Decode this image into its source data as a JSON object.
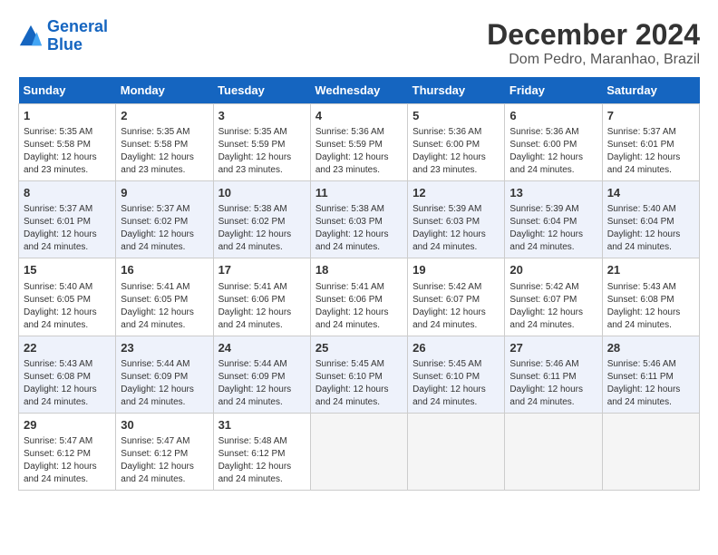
{
  "header": {
    "logo_line1": "General",
    "logo_line2": "Blue",
    "title": "December 2024",
    "subtitle": "Dom Pedro, Maranhao, Brazil"
  },
  "calendar": {
    "days_of_week": [
      "Sunday",
      "Monday",
      "Tuesday",
      "Wednesday",
      "Thursday",
      "Friday",
      "Saturday"
    ],
    "weeks": [
      [
        {
          "day": "",
          "detail": ""
        },
        {
          "day": "2",
          "detail": "Sunrise: 5:35 AM\nSunset: 5:58 PM\nDaylight: 12 hours\nand 23 minutes."
        },
        {
          "day": "3",
          "detail": "Sunrise: 5:35 AM\nSunset: 5:59 PM\nDaylight: 12 hours\nand 23 minutes."
        },
        {
          "day": "4",
          "detail": "Sunrise: 5:36 AM\nSunset: 5:59 PM\nDaylight: 12 hours\nand 23 minutes."
        },
        {
          "day": "5",
          "detail": "Sunrise: 5:36 AM\nSunset: 6:00 PM\nDaylight: 12 hours\nand 23 minutes."
        },
        {
          "day": "6",
          "detail": "Sunrise: 5:36 AM\nSunset: 6:00 PM\nDaylight: 12 hours\nand 24 minutes."
        },
        {
          "day": "7",
          "detail": "Sunrise: 5:37 AM\nSunset: 6:01 PM\nDaylight: 12 hours\nand 24 minutes."
        }
      ],
      [
        {
          "day": "8",
          "detail": "Sunrise: 5:37 AM\nSunset: 6:01 PM\nDaylight: 12 hours\nand 24 minutes."
        },
        {
          "day": "9",
          "detail": "Sunrise: 5:37 AM\nSunset: 6:02 PM\nDaylight: 12 hours\nand 24 minutes."
        },
        {
          "day": "10",
          "detail": "Sunrise: 5:38 AM\nSunset: 6:02 PM\nDaylight: 12 hours\nand 24 minutes."
        },
        {
          "day": "11",
          "detail": "Sunrise: 5:38 AM\nSunset: 6:03 PM\nDaylight: 12 hours\nand 24 minutes."
        },
        {
          "day": "12",
          "detail": "Sunrise: 5:39 AM\nSunset: 6:03 PM\nDaylight: 12 hours\nand 24 minutes."
        },
        {
          "day": "13",
          "detail": "Sunrise: 5:39 AM\nSunset: 6:04 PM\nDaylight: 12 hours\nand 24 minutes."
        },
        {
          "day": "14",
          "detail": "Sunrise: 5:40 AM\nSunset: 6:04 PM\nDaylight: 12 hours\nand 24 minutes."
        }
      ],
      [
        {
          "day": "15",
          "detail": "Sunrise: 5:40 AM\nSunset: 6:05 PM\nDaylight: 12 hours\nand 24 minutes."
        },
        {
          "day": "16",
          "detail": "Sunrise: 5:41 AM\nSunset: 6:05 PM\nDaylight: 12 hours\nand 24 minutes."
        },
        {
          "day": "17",
          "detail": "Sunrise: 5:41 AM\nSunset: 6:06 PM\nDaylight: 12 hours\nand 24 minutes."
        },
        {
          "day": "18",
          "detail": "Sunrise: 5:41 AM\nSunset: 6:06 PM\nDaylight: 12 hours\nand 24 minutes."
        },
        {
          "day": "19",
          "detail": "Sunrise: 5:42 AM\nSunset: 6:07 PM\nDaylight: 12 hours\nand 24 minutes."
        },
        {
          "day": "20",
          "detail": "Sunrise: 5:42 AM\nSunset: 6:07 PM\nDaylight: 12 hours\nand 24 minutes."
        },
        {
          "day": "21",
          "detail": "Sunrise: 5:43 AM\nSunset: 6:08 PM\nDaylight: 12 hours\nand 24 minutes."
        }
      ],
      [
        {
          "day": "22",
          "detail": "Sunrise: 5:43 AM\nSunset: 6:08 PM\nDaylight: 12 hours\nand 24 minutes."
        },
        {
          "day": "23",
          "detail": "Sunrise: 5:44 AM\nSunset: 6:09 PM\nDaylight: 12 hours\nand 24 minutes."
        },
        {
          "day": "24",
          "detail": "Sunrise: 5:44 AM\nSunset: 6:09 PM\nDaylight: 12 hours\nand 24 minutes."
        },
        {
          "day": "25",
          "detail": "Sunrise: 5:45 AM\nSunset: 6:10 PM\nDaylight: 12 hours\nand 24 minutes."
        },
        {
          "day": "26",
          "detail": "Sunrise: 5:45 AM\nSunset: 6:10 PM\nDaylight: 12 hours\nand 24 minutes."
        },
        {
          "day": "27",
          "detail": "Sunrise: 5:46 AM\nSunset: 6:11 PM\nDaylight: 12 hours\nand 24 minutes."
        },
        {
          "day": "28",
          "detail": "Sunrise: 5:46 AM\nSunset: 6:11 PM\nDaylight: 12 hours\nand 24 minutes."
        }
      ],
      [
        {
          "day": "29",
          "detail": "Sunrise: 5:47 AM\nSunset: 6:12 PM\nDaylight: 12 hours\nand 24 minutes."
        },
        {
          "day": "30",
          "detail": "Sunrise: 5:47 AM\nSunset: 6:12 PM\nDaylight: 12 hours\nand 24 minutes."
        },
        {
          "day": "31",
          "detail": "Sunrise: 5:48 AM\nSunset: 6:12 PM\nDaylight: 12 hours\nand 24 minutes."
        },
        {
          "day": "",
          "detail": ""
        },
        {
          "day": "",
          "detail": ""
        },
        {
          "day": "",
          "detail": ""
        },
        {
          "day": "",
          "detail": ""
        }
      ]
    ],
    "week1_sunday": {
      "day": "1",
      "detail": "Sunrise: 5:35 AM\nSunset: 5:58 PM\nDaylight: 12 hours\nand 23 minutes."
    }
  }
}
